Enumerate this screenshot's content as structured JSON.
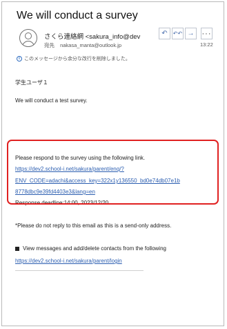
{
  "email": {
    "subject": "We will conduct a survey",
    "sender": "さくら連絡網 <sakura_info@dev",
    "to_label": "宛先",
    "to_address": "nakasa_manta@outlook.jp",
    "time": "13:22",
    "notice": "このメッセージから余分な改行を削除しました。",
    "actions": {
      "reply": "↶",
      "reply_all": "↶↶",
      "forward": "→",
      "more": "···"
    }
  },
  "body": {
    "greeting": "学生ユーザ１",
    "intro": "We will conduct a test survey.",
    "respond": "Please respond to the survey using the following link.",
    "survey_link_lines": [
      "https://dev2.school-i.net/sakura/parent/enq/?",
      "ENV_CODE=adachi&access_key=322x1y136550_bd0e74db07e1b",
      "8778dbc9e39fd4403e3&lang=en"
    ],
    "deadline": "Response deadline:14:00, 2023/12/20",
    "no_reply": "*Please do not reply to this email as this is a send-only address.",
    "view_messages": "View messages and add/delete contacts from the following",
    "login_link": "https://dev2.school-i.net/sakura/parent/login"
  }
}
